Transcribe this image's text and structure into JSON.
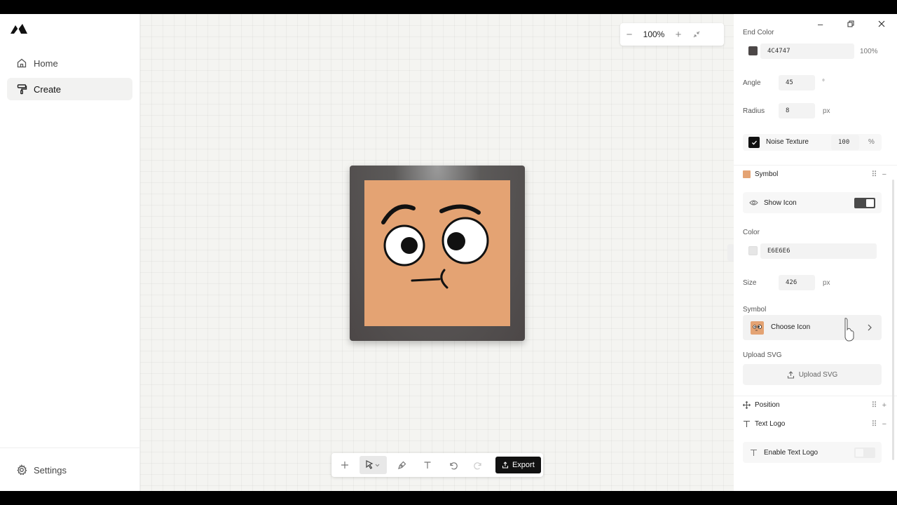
{
  "nav": {
    "items": [
      {
        "label": "Home",
        "icon": "home-icon"
      },
      {
        "label": "Create",
        "icon": "paint-roller-icon"
      }
    ],
    "settings_label": "Settings"
  },
  "zoom": {
    "value": "100%"
  },
  "toolbar": {
    "export_label": "Export"
  },
  "panel": {
    "end_color": {
      "label": "End Color",
      "hex": "4C4747",
      "opacity": "100%",
      "swatch": "#4c4747"
    },
    "angle": {
      "label": "Angle",
      "value": "45",
      "unit": "°"
    },
    "radius": {
      "label": "Radius",
      "value": "8",
      "unit": "px"
    },
    "noise": {
      "label": "Noise Texture",
      "value": "100",
      "unit": "%",
      "checked": true
    },
    "symbol_section": {
      "title": "Symbol"
    },
    "show_icon": {
      "label": "Show Icon",
      "on": true
    },
    "color": {
      "label": "Color",
      "hex": "E6E6E6",
      "swatch": "#e6e6e6"
    },
    "size": {
      "label": "Size",
      "value": "426",
      "unit": "px"
    },
    "symbol": {
      "label": "Symbol",
      "choose_label": "Choose Icon"
    },
    "upload": {
      "label": "Upload SVG",
      "button_label": "Upload SVG"
    },
    "position_section": {
      "title": "Position"
    },
    "text_logo_section": {
      "title": "Text Logo"
    },
    "enable_text_logo": {
      "label": "Enable Text Logo",
      "on": false
    }
  },
  "colors": {
    "logo_fill": "#e4a373",
    "frame": "#4c4747",
    "accent": "#111111"
  }
}
